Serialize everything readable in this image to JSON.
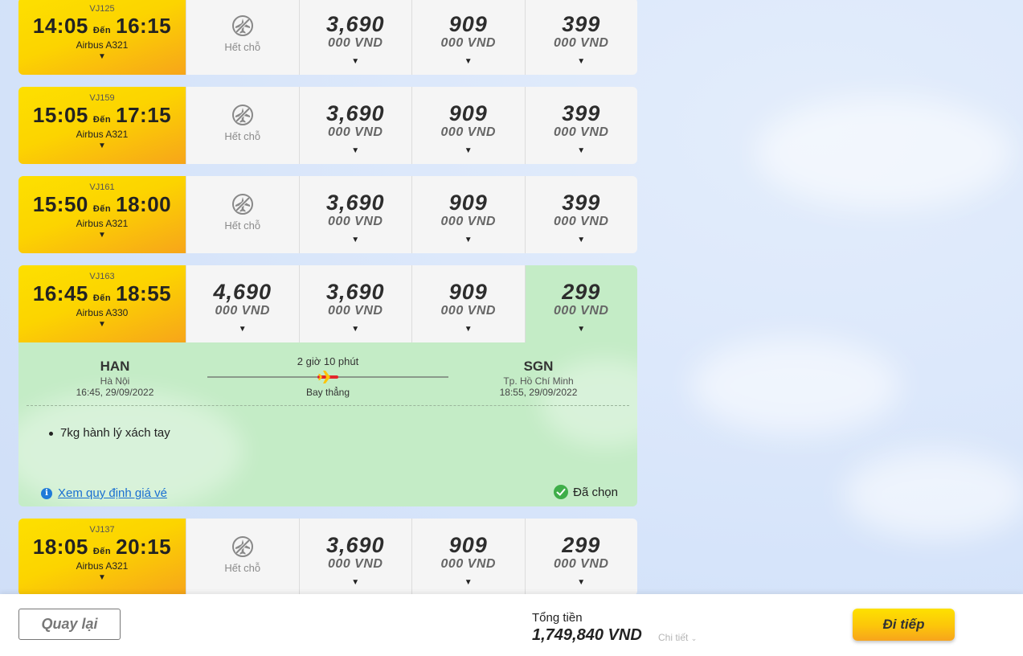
{
  "flights": [
    {
      "flight_no": "VJ125",
      "depart": "14:05",
      "to_word": "Đến",
      "arrive": "16:15",
      "aircraft": "Airbus A321",
      "fares": [
        {
          "soldout": true,
          "soldout_label": "Hết chỗ"
        },
        {
          "price": "3,690",
          "unit": "000 VND"
        },
        {
          "price": "909",
          "unit": "000 VND"
        },
        {
          "price": "399",
          "unit": "000 VND"
        }
      ]
    },
    {
      "flight_no": "VJ159",
      "depart": "15:05",
      "to_word": "Đến",
      "arrive": "17:15",
      "aircraft": "Airbus A321",
      "fares": [
        {
          "soldout": true,
          "soldout_label": "Hết chỗ"
        },
        {
          "price": "3,690",
          "unit": "000 VND"
        },
        {
          "price": "909",
          "unit": "000 VND"
        },
        {
          "price": "399",
          "unit": "000 VND"
        }
      ]
    },
    {
      "flight_no": "VJ161",
      "depart": "15:50",
      "to_word": "Đến",
      "arrive": "18:00",
      "aircraft": "Airbus A321",
      "fares": [
        {
          "soldout": true,
          "soldout_label": "Hết chỗ"
        },
        {
          "price": "3,690",
          "unit": "000 VND"
        },
        {
          "price": "909",
          "unit": "000 VND"
        },
        {
          "price": "399",
          "unit": "000 VND"
        }
      ]
    },
    {
      "flight_no": "VJ163",
      "depart": "16:45",
      "to_word": "Đến",
      "arrive": "18:55",
      "aircraft": "Airbus A330",
      "fares": [
        {
          "price": "4,690",
          "unit": "000 VND"
        },
        {
          "price": "3,690",
          "unit": "000 VND"
        },
        {
          "price": "909",
          "unit": "000 VND"
        },
        {
          "price": "299",
          "unit": "000 VND",
          "selected": true
        }
      ]
    },
    {
      "flight_no": "VJ137",
      "depart": "18:05",
      "to_word": "Đến",
      "arrive": "20:15",
      "aircraft": "Airbus A321",
      "fares": [
        {
          "soldout": true,
          "soldout_label": "Hết chỗ"
        },
        {
          "price": "3,690",
          "unit": "000 VND"
        },
        {
          "price": "909",
          "unit": "000 VND"
        },
        {
          "price": "299",
          "unit": "000 VND"
        }
      ]
    }
  ],
  "detail": {
    "origin": {
      "code": "HAN",
      "city": "Hà Nội",
      "datetime": "16:45, 29/09/2022"
    },
    "destination": {
      "code": "SGN",
      "city": "Tp. Hồ Chí Minh",
      "datetime": "18:55, 29/09/2022"
    },
    "duration": "2 giờ 10 phút",
    "stops": "Bay thẳng",
    "baggage": "7kg hành lý xách tay",
    "rules_link": "Xem quy định giá vé",
    "selected_label": "Đã chọn"
  },
  "footer": {
    "back_label": "Quay lại",
    "total_label": "Tổng tiền",
    "total_value": "1,749,840 VND",
    "detail_label": "Chi tiết",
    "next_label": "Đi tiếp"
  },
  "colors": {
    "yellow": "#fcd400",
    "orange": "#f7a51a",
    "selected_green": "#c4ecc6",
    "link_blue": "#1a6fd1",
    "plane_red": "#e3262b"
  }
}
